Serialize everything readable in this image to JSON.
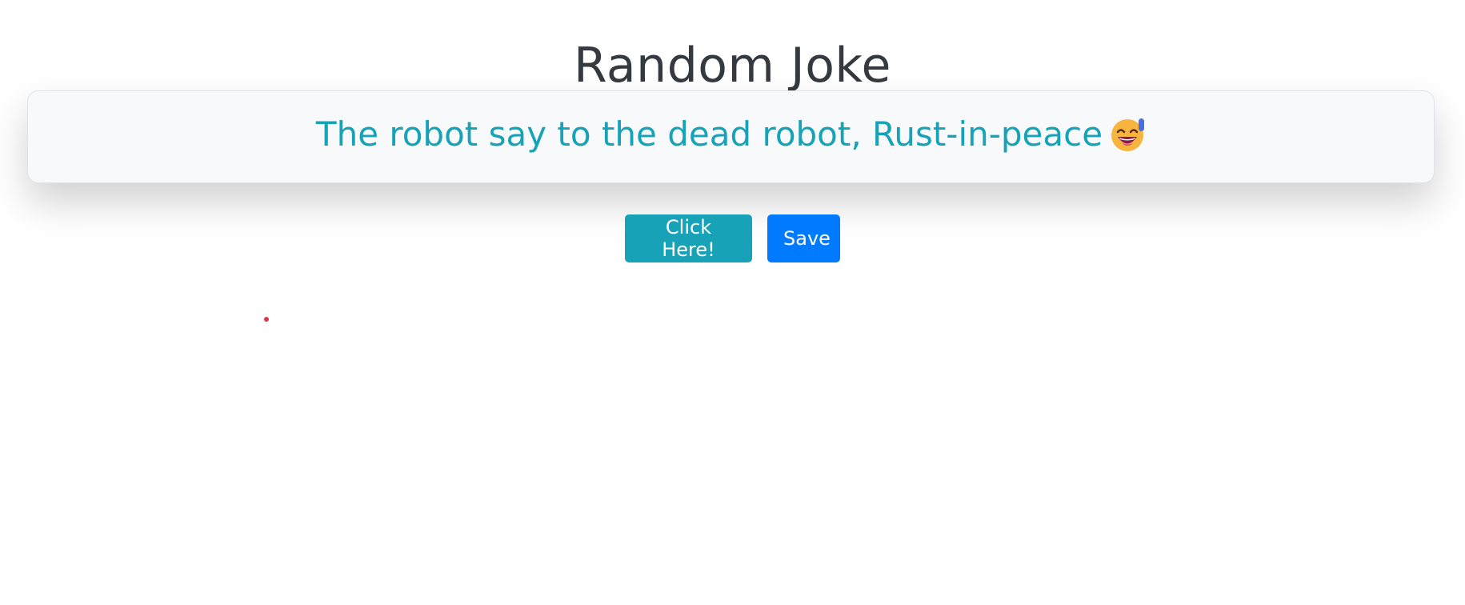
{
  "page": {
    "title": "Random Joke"
  },
  "joke": {
    "text": "The robot say to the dead robot, Rust-in-peace",
    "emoji_icon": "grinning-sweat-emoji-icon"
  },
  "actions": {
    "click_label": "Click Here!",
    "save_label": "Save"
  },
  "colors": {
    "title": "#343a40",
    "joke_text": "#17a2b8",
    "card_bg": "#f8f9fa",
    "info_button": "#17a2b8",
    "primary_button": "#007bff",
    "marker_dot": "#dc3545"
  }
}
